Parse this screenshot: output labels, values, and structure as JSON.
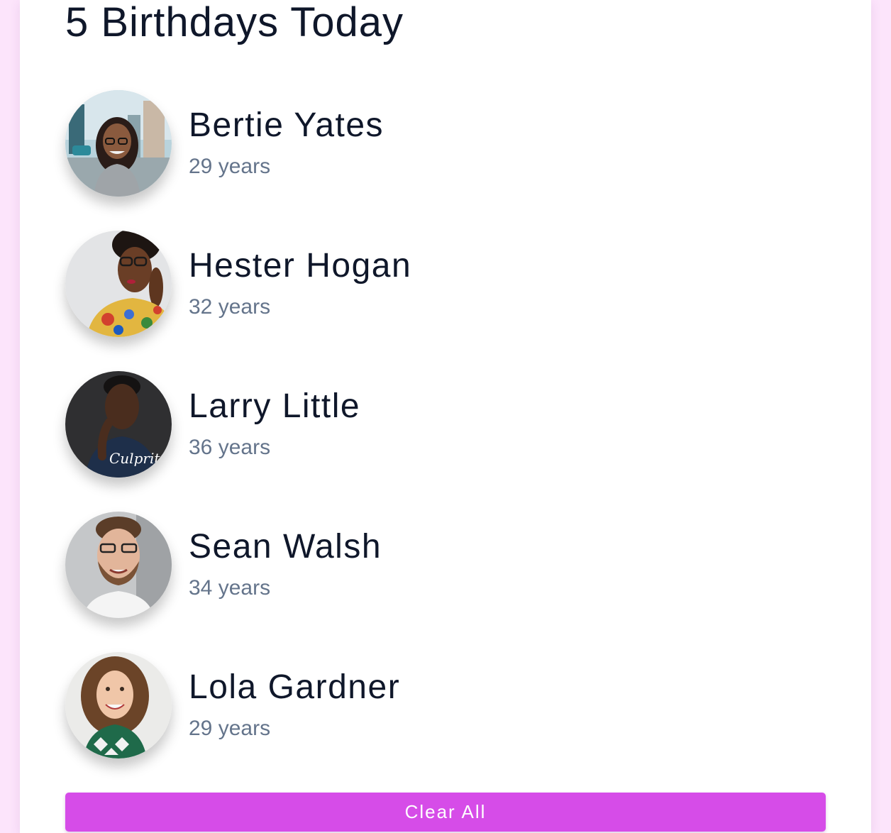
{
  "title": "5 Birthdays Today",
  "people": [
    {
      "name": "Bertie Yates",
      "age": "29 years",
      "avatar": "portrait-woman-glasses-street"
    },
    {
      "name": "Hester Hogan",
      "age": "32 years",
      "avatar": "portrait-woman-glasses-floral"
    },
    {
      "name": "Larry Little",
      "age": "36 years",
      "avatar": "portrait-man-dark-tshirt"
    },
    {
      "name": "Sean Walsh",
      "age": "34 years",
      "avatar": "portrait-man-glasses-beard"
    },
    {
      "name": "Lola Gardner",
      "age": "29 years",
      "avatar": "portrait-woman-curly-hair"
    }
  ],
  "button": {
    "label": "Clear All"
  },
  "colors": {
    "page_background": "#fce4fb",
    "card_background": "#ffffff",
    "name_text": "#0f172a",
    "age_text": "#64748b",
    "button_background": "#d64ce8",
    "button_text": "#ffffff"
  }
}
